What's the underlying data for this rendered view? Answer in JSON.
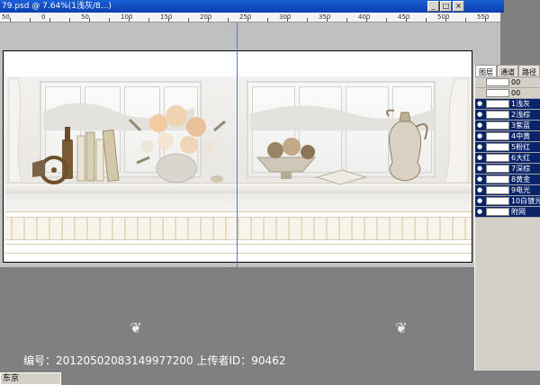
{
  "document": {
    "title": "79.psd @ 7.64%(1浅灰/8...)"
  },
  "window_buttons": [
    "_",
    "□",
    "×"
  ],
  "ruler": {
    "labels": [
      "50",
      "0",
      "50",
      "100",
      "150",
      "200",
      "250",
      "300",
      "350",
      "400",
      "450",
      "500",
      "550"
    ]
  },
  "layers_panel": {
    "tabs": [
      "图层",
      "通道",
      "路径"
    ],
    "rows": [
      {
        "name": "00",
        "selected": false,
        "visible": false
      },
      {
        "name": "00",
        "selected": false,
        "visible": false
      },
      {
        "name": "1浅灰",
        "selected": true,
        "visible": true
      },
      {
        "name": "2浅棕",
        "selected": true,
        "visible": true
      },
      {
        "name": "3紫蓝",
        "selected": true,
        "visible": true
      },
      {
        "name": "4中黄",
        "selected": true,
        "visible": true
      },
      {
        "name": "5粉红",
        "selected": true,
        "visible": true
      },
      {
        "name": "6大红",
        "selected": true,
        "visible": true
      },
      {
        "name": "7深棕",
        "selected": true,
        "visible": true
      },
      {
        "name": "8黄金",
        "selected": true,
        "visible": true
      },
      {
        "name": "9电光",
        "selected": true,
        "visible": true
      },
      {
        "name": "10白镀光",
        "selected": true,
        "visible": true
      },
      {
        "name": "附网",
        "selected": true,
        "visible": true
      }
    ]
  },
  "status_bar": {
    "tool": "东京"
  },
  "watermark": {
    "text": "编号：20120502083149977200 上传者ID：90462"
  }
}
